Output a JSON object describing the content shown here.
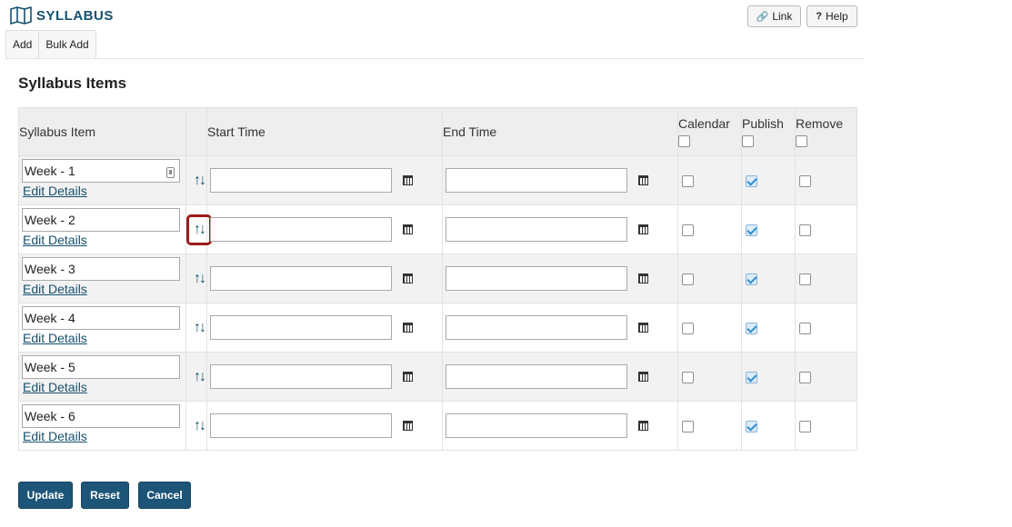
{
  "app": {
    "title": "SYLLABUS",
    "icon": "map-icon"
  },
  "toolbar": {
    "link_label": "Link",
    "help_label": "Help"
  },
  "tabs": [
    {
      "label": "Add"
    },
    {
      "label": "Bulk Add"
    }
  ],
  "section_title": "Syllabus Items",
  "table": {
    "headers": {
      "item": "Syllabus Item",
      "start": "Start Time",
      "end": "End Time",
      "calendar": "Calendar",
      "publish": "Publish",
      "remove": "Remove"
    },
    "header_checks": {
      "calendar": false,
      "publish": false,
      "remove": false
    },
    "edit_label": "Edit Details",
    "rows": [
      {
        "title": "Week - 1",
        "start": "",
        "end": "",
        "calendar": false,
        "publish": true,
        "remove": false
      },
      {
        "title": "Week - 2",
        "start": "",
        "end": "",
        "calendar": false,
        "publish": true,
        "remove": false
      },
      {
        "title": "Week - 3",
        "start": "",
        "end": "",
        "calendar": false,
        "publish": true,
        "remove": false
      },
      {
        "title": "Week - 4",
        "start": "",
        "end": "",
        "calendar": false,
        "publish": true,
        "remove": false
      },
      {
        "title": "Week - 5",
        "start": "",
        "end": "",
        "calendar": false,
        "publish": true,
        "remove": false
      },
      {
        "title": "Week - 6",
        "start": "",
        "end": "",
        "calendar": false,
        "publish": true,
        "remove": false
      }
    ]
  },
  "actions": {
    "update": "Update",
    "reset": "Reset",
    "cancel": "Cancel"
  },
  "colors": {
    "brand": "#15516f",
    "button": "#1d5578",
    "highlight": "#9c1b1b"
  }
}
